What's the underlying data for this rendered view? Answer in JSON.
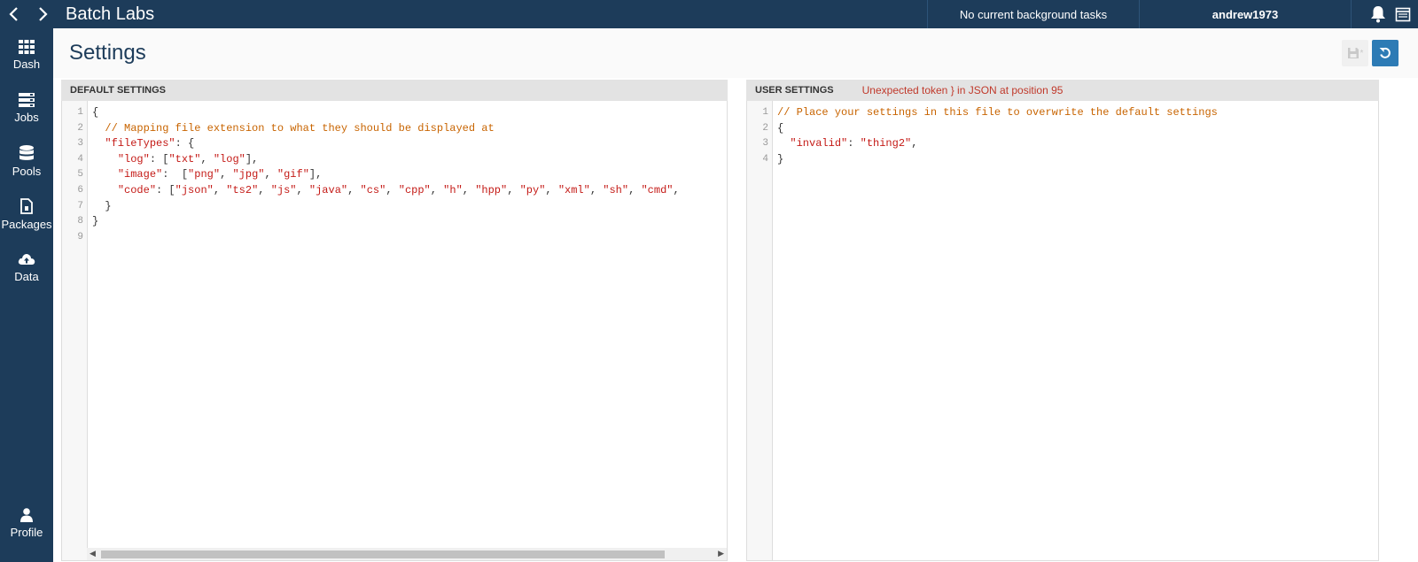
{
  "window": {
    "title": "Batch Labs"
  },
  "topbar": {
    "background_tasks": "No current background tasks",
    "user": "andrew1973",
    "icons": [
      "chevron-left-icon",
      "chevron-right-icon",
      "bell-icon",
      "calendar-icon"
    ]
  },
  "sidebar": {
    "items": [
      {
        "label": "Dash",
        "icon": "grid-icon"
      },
      {
        "label": "Jobs",
        "icon": "server-icon"
      },
      {
        "label": "Pools",
        "icon": "database-icon"
      },
      {
        "label": "Packages",
        "icon": "file-icon"
      },
      {
        "label": "Data",
        "icon": "cloud-upload-icon"
      }
    ],
    "profile": {
      "label": "Profile",
      "icon": "user-icon"
    }
  },
  "page": {
    "title": "Settings"
  },
  "default_settings": {
    "title": "DEFAULT SETTINGS",
    "lines": [
      "{",
      "  // Mapping file extension to what they should be displayed at",
      "  \"fileTypes\": {",
      "    \"log\": [\"txt\", \"log\"],",
      "    \"image\":  [\"png\", \"jpg\", \"gif\"],",
      "    \"code\": [\"json\", \"ts2\", \"js\", \"java\", \"cs\", \"cpp\", \"h\", \"hpp\", \"py\", \"xml\", \"sh\", \"cmd\",",
      "  }",
      "}",
      ""
    ],
    "line_numbers": [
      "1",
      "2",
      "3",
      "4",
      "5",
      "6",
      "7",
      "8",
      "9"
    ]
  },
  "user_settings": {
    "title": "USER SETTINGS",
    "error": "Unexpected token } in JSON at position 95",
    "lines": [
      "// Place your settings in this file to overwrite the default settings",
      "{",
      "  \"invalid\": \"thing2\",",
      "}"
    ],
    "line_numbers": [
      "1",
      "2",
      "3",
      "4"
    ]
  },
  "colors": {
    "header_bg": "#1d3c5a",
    "accent": "#2d7bb5",
    "error": "#c0392b",
    "code_string": "#c41a16",
    "code_comment": "#c86400"
  }
}
